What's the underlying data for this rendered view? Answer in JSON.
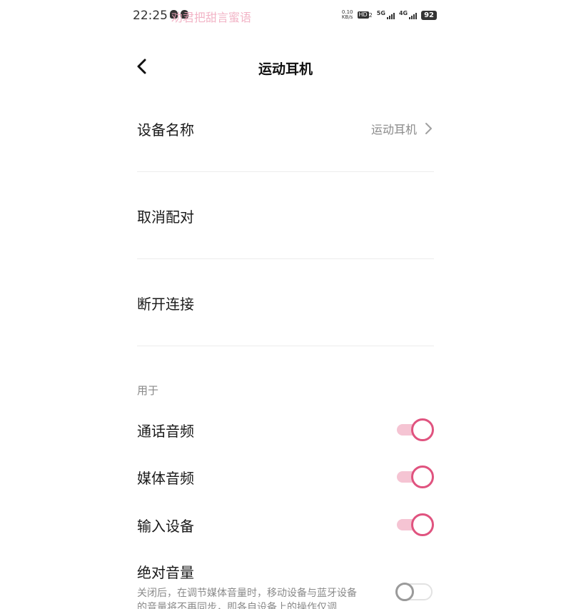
{
  "status_bar": {
    "time": "22:25",
    "watermark": "劝君把甜言蜜语",
    "net_speed_value": "0.10",
    "net_speed_unit": "KB/s",
    "hd_badge": "HD",
    "hd_sub": "2",
    "signal_1_label": "5G",
    "signal_2_label": "4G",
    "battery": "92"
  },
  "header": {
    "title": "运动耳机"
  },
  "rows": {
    "device_name_label": "设备名称",
    "device_name_value": "运动耳机",
    "unpair_label": "取消配对",
    "disconnect_label": "断开连接"
  },
  "section": {
    "used_for": "用于"
  },
  "toggles": [
    {
      "label": "通话音频",
      "state": "on"
    },
    {
      "label": "媒体音频",
      "state": "on"
    },
    {
      "label": "输入设备",
      "state": "on"
    }
  ],
  "absolute_volume": {
    "label": "绝对音量",
    "description": "关闭后，在调节媒体音量时，移动设备与蓝牙设备的音量将不再同步，即各自设备上的操作仅调",
    "state": "off"
  },
  "colors": {
    "accent": "#e0537f",
    "accent_track": "#f5c4d3"
  }
}
